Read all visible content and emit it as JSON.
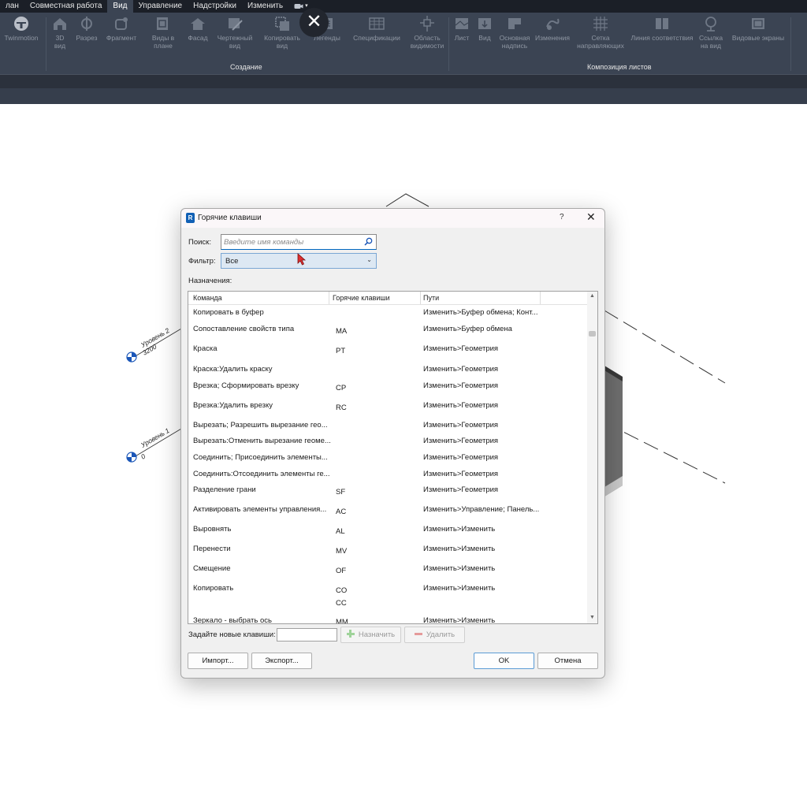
{
  "ribbon": {
    "tabs": [
      {
        "label": "лан"
      },
      {
        "label": "Совместная работа"
      },
      {
        "label": "Вид"
      },
      {
        "label": "Управление"
      },
      {
        "label": "Надстройки"
      },
      {
        "label": "Изменить"
      }
    ],
    "active_tab": "Вид",
    "buttons": {
      "twinmotion": "Twinmotion",
      "view3d": "3D вид",
      "section": "Разрез",
      "fragment": "Фрагмент",
      "plan_views": "Виды в плане",
      "elevation": "Фасад",
      "drafting_view": "Чертежный вид",
      "duplicate_view": "Копировать вид",
      "legends": "Легенды",
      "schedules": "Спецификации",
      "scope_box": "Область видимости",
      "sheet": "Лист",
      "view": "Вид",
      "title_block": "Основная надпись",
      "revisions": "Изменения",
      "guide_grid": "Сетка направляющих",
      "matchline": "Линия соответствия",
      "view_reference": "Ссылка на вид",
      "viewports": "Видовые экраны"
    },
    "panels": {
      "create": "Создание",
      "sheet_composition": "Композиция листов"
    },
    "icons": [
      "twinmotion-icon",
      "house-3d-icon",
      "section-icon",
      "callout-icon",
      "plan-view-icon",
      "elevation-icon",
      "drafting-view-icon",
      "duplicate-view-icon",
      "legend-icon",
      "schedule-icon",
      "scope-box-icon",
      "sheet-icon",
      "place-view-icon",
      "title-block-icon",
      "revision-icon",
      "grid-icon",
      "matchline-icon",
      "view-reference-icon",
      "viewports-icon"
    ]
  },
  "drawing": {
    "level2_name": "Уровень 2",
    "level2_elev": "3200",
    "level1_name": "Уровень 1",
    "level1_elev": "0"
  },
  "dialog": {
    "title": "Горячие клавиши",
    "help": "?",
    "search_label": "Поиск:",
    "search_placeholder": "Введите имя команды",
    "search_value": "",
    "filter_label": "Фильтр:",
    "filter_value": "Все",
    "assignments_label": "Назначения:",
    "columns": {
      "command": "Команда",
      "shortcuts": "Горячие клавиши",
      "paths": "Пути"
    },
    "rows": [
      {
        "command": "Копировать в буфер",
        "keys": "",
        "path": "Изменить>Буфер обмена; Конт..."
      },
      {
        "command": "Сопоставление свойств типа",
        "keys": "MA",
        "path": "Изменить>Буфер обмена"
      },
      {
        "command": "Краска",
        "keys": "PT",
        "path": "Изменить>Геометрия"
      },
      {
        "command": "Краска:Удалить краску",
        "keys": "",
        "path": "Изменить>Геометрия"
      },
      {
        "command": "Врезка; Сформировать врезку",
        "keys": "CP",
        "path": "Изменить>Геометрия"
      },
      {
        "command": "Врезка:Удалить врезку",
        "keys": "RC",
        "path": "Изменить>Геометрия"
      },
      {
        "command": "Вырезать; Разрешить вырезание гео...",
        "keys": "",
        "path": "Изменить>Геометрия"
      },
      {
        "command": "Вырезать:Отменить вырезание геоме...",
        "keys": "",
        "path": "Изменить>Геометрия"
      },
      {
        "command": "Соединить; Присоединить элементы...",
        "keys": "",
        "path": "Изменить>Геометрия"
      },
      {
        "command": "Соединить:Отсоединить элементы ге...",
        "keys": "",
        "path": "Изменить>Геометрия"
      },
      {
        "command": "Разделение грани",
        "keys": "SF",
        "path": "Изменить>Геометрия"
      },
      {
        "command": "Активировать элементы управления...",
        "keys": "AC",
        "path": "Изменить>Управление; Панель..."
      },
      {
        "command": "Выровнять",
        "keys": "AL",
        "path": "Изменить>Изменить"
      },
      {
        "command": "Перенести",
        "keys": "MV",
        "path": "Изменить>Изменить"
      },
      {
        "command": "Смещение",
        "keys": "OF",
        "path": "Изменить>Изменить"
      },
      {
        "command": "Копировать",
        "keys": "CO",
        "keys2": "CC",
        "path": "Изменить>Изменить"
      },
      {
        "command": "Зеркало - выбрать ось",
        "keys": "MM",
        "path": "Изменить>Изменить"
      }
    ],
    "new_keys_label": "Задайте новые клавиши:",
    "assign_button": "Назначить",
    "delete_button": "Удалить",
    "import_button": "Импорт...",
    "export_button": "Экспорт...",
    "ok_button": "OK",
    "cancel_button": "Отмена"
  },
  "overlay": {
    "close_glyph": "✕"
  },
  "colors": {
    "ribbon_bg": "#3b4453",
    "ribbon_tabs_bg": "#1b1f27",
    "accent": "#0067c0",
    "cursor": "#e03030"
  }
}
